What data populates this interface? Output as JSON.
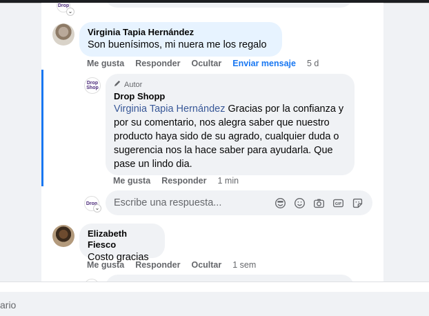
{
  "comments": [
    {
      "author": "Virginia Tapia Hernández",
      "text": "Son buenísimos, mi nuera me los regalo",
      "actions": {
        "like": "Me gusta",
        "reply": "Responder",
        "hide": "Ocultar",
        "message": "Enviar mensaje",
        "time": "5 d"
      }
    },
    {
      "badge": "Autor",
      "author": "Drop Shopp",
      "mention": "Virginia Tapia Hernández",
      "text": " Gracias por la confianza y por su comentario, nos alegra saber que nuestro producto haya sido de su agrado, cualquier duda o sugerencia nos la hace saber para ayudarla. Que pase un lindo dia.",
      "actions": {
        "like": "Me gusta",
        "reply": "Responder",
        "time": "1 min"
      }
    },
    {
      "author": "Elizabeth Fiesco",
      "text": "Costo gracias",
      "actions": {
        "like": "Me gusta",
        "reply": "Responder",
        "hide": "Ocultar",
        "time": "1 sem"
      }
    }
  ],
  "reply_box": {
    "placeholder": "Escribe una respuesta..."
  },
  "shop_logo": {
    "line1": "Drop",
    "line2": "Shop"
  },
  "bottom_input": {
    "visible_text": "ario"
  },
  "icons": [
    "pencil-icon",
    "avatar-sticker-icon",
    "emoji-icon",
    "camera-icon",
    "gif-icon",
    "sticker-icon",
    "chevron-down-icon"
  ],
  "colors": {
    "link_blue": "#1877f2",
    "mention": "#385898",
    "bubble": "#f0f2f5",
    "highlight_bubble": "#e7f3ff"
  }
}
